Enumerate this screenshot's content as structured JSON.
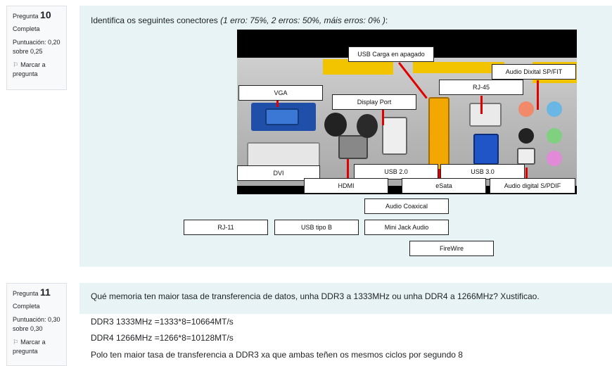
{
  "q10": {
    "label": "Pregunta",
    "number": "10",
    "status": "Completa",
    "score": "Puntuación: 0,20 sobre 0,25",
    "flag": "Marcar a pregunta",
    "question_main": "Identifica os seguintes conectores ",
    "question_italic": "(1 erro: 75%, 2 erros: 50%, máis erros: 0% )",
    "question_end": ":",
    "placed_labels": {
      "usb_carga": "USB Carga en apagado",
      "audio_spfit": "Audio Dixital SP/FIT",
      "rj45": "RJ-45",
      "vga": "VGA",
      "display_port": "Display Port",
      "dvi": "DVI",
      "usb20": "USB 2.0",
      "usb30": "USB 3.0",
      "hdmi": "HDMI",
      "esata": "eSata",
      "audio_spdif": "Audio digital S/PDIF"
    },
    "choices": {
      "audio_coaxical": "Audio Coaxical",
      "rj11": "RJ-11",
      "usb_tipo_b": "USB tipo B",
      "mini_jack": "Mini Jack Audio",
      "firewire": "FireWire"
    }
  },
  "q11": {
    "label": "Pregunta",
    "number": "11",
    "status": "Completa",
    "score": "Puntuación: 0,30 sobre 0,30",
    "flag": "Marcar a pregunta",
    "question": "Qué memoria ten maior tasa de transferencia de datos, unha DDR3 a 1333MHz ou unha DDR4 a 1266MHz? Xustificao.",
    "answer_lines": [
      "DDR3 1333MHz =1333*8=10664MT/s",
      "DDR4 1266MHz =1266*8=10128MT/s",
      "Polo ten maior tasa de transferencia a DDR3 xa que ambas teñen os mesmos ciclos por segundo 8"
    ]
  },
  "colors": {
    "panel": "#e7f3f5",
    "info_bg": "#f8f9fa",
    "red_line": "#e00000"
  },
  "icons": {
    "flag": "flag-icon"
  }
}
